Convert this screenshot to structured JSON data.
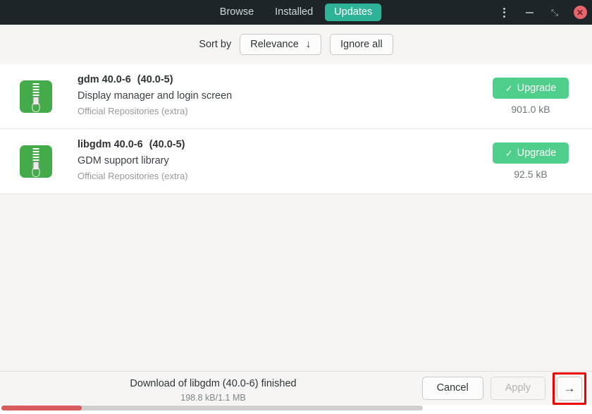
{
  "header": {
    "tabs": [
      {
        "label": "Browse",
        "active": false
      },
      {
        "label": "Installed",
        "active": false
      },
      {
        "label": "Updates",
        "active": true
      }
    ],
    "window_controls": {
      "menu": "menu-icon",
      "minimize": "–",
      "maximize": "⤡",
      "close": "✕"
    },
    "accent_color": "#2eb398",
    "background_color": "#1d2528"
  },
  "toolbar": {
    "sort_label": "Sort by",
    "sort_value": "Relevance",
    "sort_arrow": "↓",
    "ignore_all_label": "Ignore all"
  },
  "packages": [
    {
      "name": "gdm",
      "new_version": "40.0-6",
      "old_version": "(40.0-5)",
      "summary": "Display manager and login screen",
      "origin": "Official Repositories (extra)",
      "action_label": "Upgrade",
      "action_check": "✓",
      "size": "901.0 kB",
      "icon": "archive-package-icon"
    },
    {
      "name": "libgdm",
      "new_version": "40.0-6",
      "old_version": "(40.0-5)",
      "summary": "GDM support library",
      "origin": "Official Repositories (extra)",
      "action_label": "Upgrade",
      "action_check": "✓",
      "size": "92.5 kB",
      "icon": "archive-package-icon"
    }
  ],
  "bottom": {
    "status_title": "Download of libgdm (40.0-6) finished",
    "status_sub": "198.8 kB/1.1 MB",
    "cancel_label": "Cancel",
    "apply_label": "Apply",
    "next_arrow": "→",
    "highlight_color": "#ee0000"
  },
  "progress": {
    "percent": 19,
    "fill_color": "#d85c5c",
    "track_color": "#cfcfcf"
  }
}
